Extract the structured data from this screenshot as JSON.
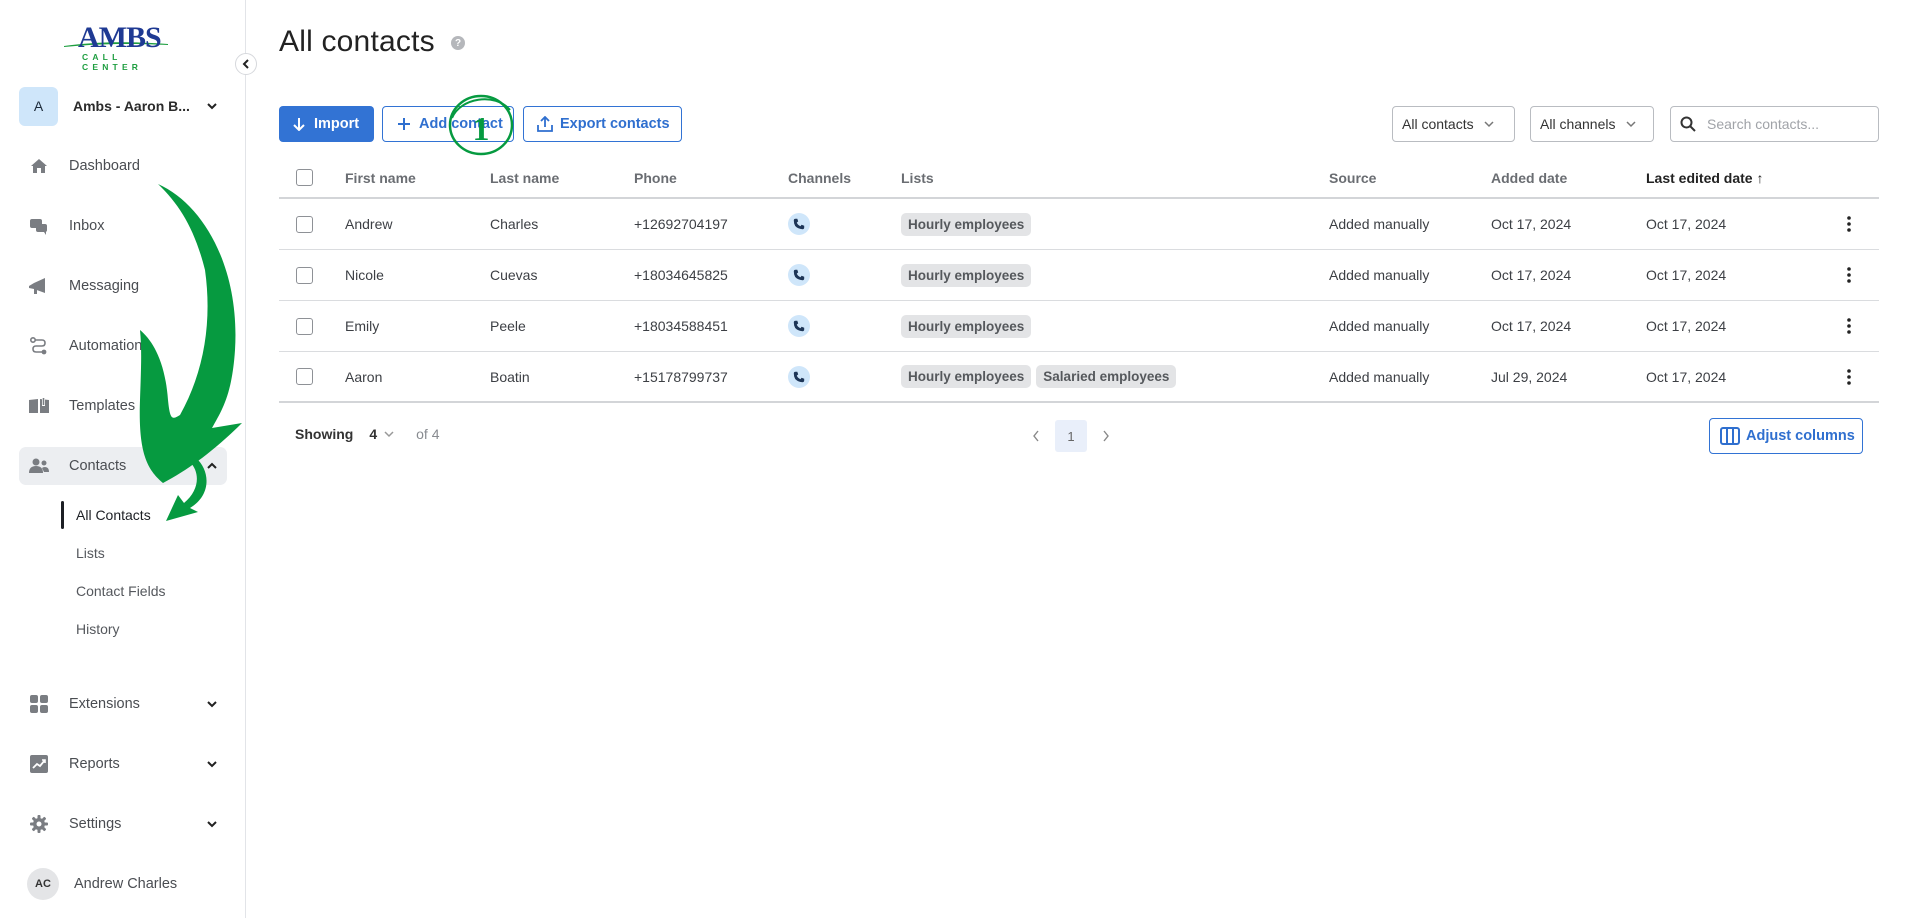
{
  "brand": {
    "logo_main": "AMBS",
    "logo_sub": "CALL CENTER"
  },
  "workspace": {
    "avatar_letter": "A",
    "name": "Ambs - Aaron B..."
  },
  "sidebar": {
    "items": [
      {
        "label": "Dashboard",
        "icon": "home-icon"
      },
      {
        "label": "Inbox",
        "icon": "chat-bubbles-icon"
      },
      {
        "label": "Messaging",
        "icon": "megaphone-icon"
      },
      {
        "label": "Automation",
        "icon": "workflow-icon"
      },
      {
        "label": "Templates",
        "icon": "book-icon"
      },
      {
        "label": "Contacts",
        "icon": "users-icon"
      },
      {
        "label": "Extensions",
        "icon": "grid-icon"
      },
      {
        "label": "Reports",
        "icon": "chart-icon"
      },
      {
        "label": "Settings",
        "icon": "gear-icon"
      }
    ],
    "contacts_sub": [
      "All Contacts",
      "Lists",
      "Contact Fields",
      "History"
    ],
    "active_item": "Contacts",
    "active_sub": "All Contacts"
  },
  "user": {
    "initials": "AC",
    "name": "Andrew Charles"
  },
  "page": {
    "title": "All contacts",
    "help": "?"
  },
  "toolbar": {
    "import_label": "Import",
    "add_label": "Add contact",
    "export_label": "Export contacts",
    "filter_contacts": "All contacts",
    "filter_channels": "All channels",
    "search_placeholder": "Search contacts...",
    "search_value": ""
  },
  "table": {
    "columns": [
      "First name",
      "Last name",
      "Phone",
      "Channels",
      "Lists",
      "Source",
      "Added date",
      "Last edited date ↑"
    ],
    "sorted_column": "Last edited date",
    "sort_direction": "ascending",
    "rows": [
      {
        "first": "Andrew",
        "last": "Charles",
        "phone": "+12692704197",
        "channel": "phone",
        "lists": [
          "Hourly employees"
        ],
        "source": "Added manually",
        "added": "Oct 17, 2024",
        "edited": "Oct 17, 2024"
      },
      {
        "first": "Nicole",
        "last": "Cuevas",
        "phone": "+18034645825",
        "channel": "phone",
        "lists": [
          "Hourly employees"
        ],
        "source": "Added manually",
        "added": "Oct 17, 2024",
        "edited": "Oct 17, 2024"
      },
      {
        "first": "Emily",
        "last": "Peele",
        "phone": "+18034588451",
        "channel": "phone",
        "lists": [
          "Hourly employees"
        ],
        "source": "Added manually",
        "added": "Oct 17, 2024",
        "edited": "Oct 17, 2024"
      },
      {
        "first": "Aaron",
        "last": "Boatin",
        "phone": "+15178799737",
        "channel": "phone",
        "lists": [
          "Hourly employees",
          "Salaried employees"
        ],
        "source": "Added manually",
        "added": "Jul 29, 2024",
        "edited": "Oct 17, 2024"
      }
    ]
  },
  "footer": {
    "showing_label": "Showing",
    "per_page": "4",
    "of_total": "of 4",
    "current_page": "1",
    "adjust_label": "Adjust columns"
  },
  "annotation": {
    "step_number": "1",
    "color": "#069a40"
  },
  "colors": {
    "primary": "#3273d4",
    "channel_bg": "#cfe6fa",
    "active_nav": "#eceef1"
  }
}
